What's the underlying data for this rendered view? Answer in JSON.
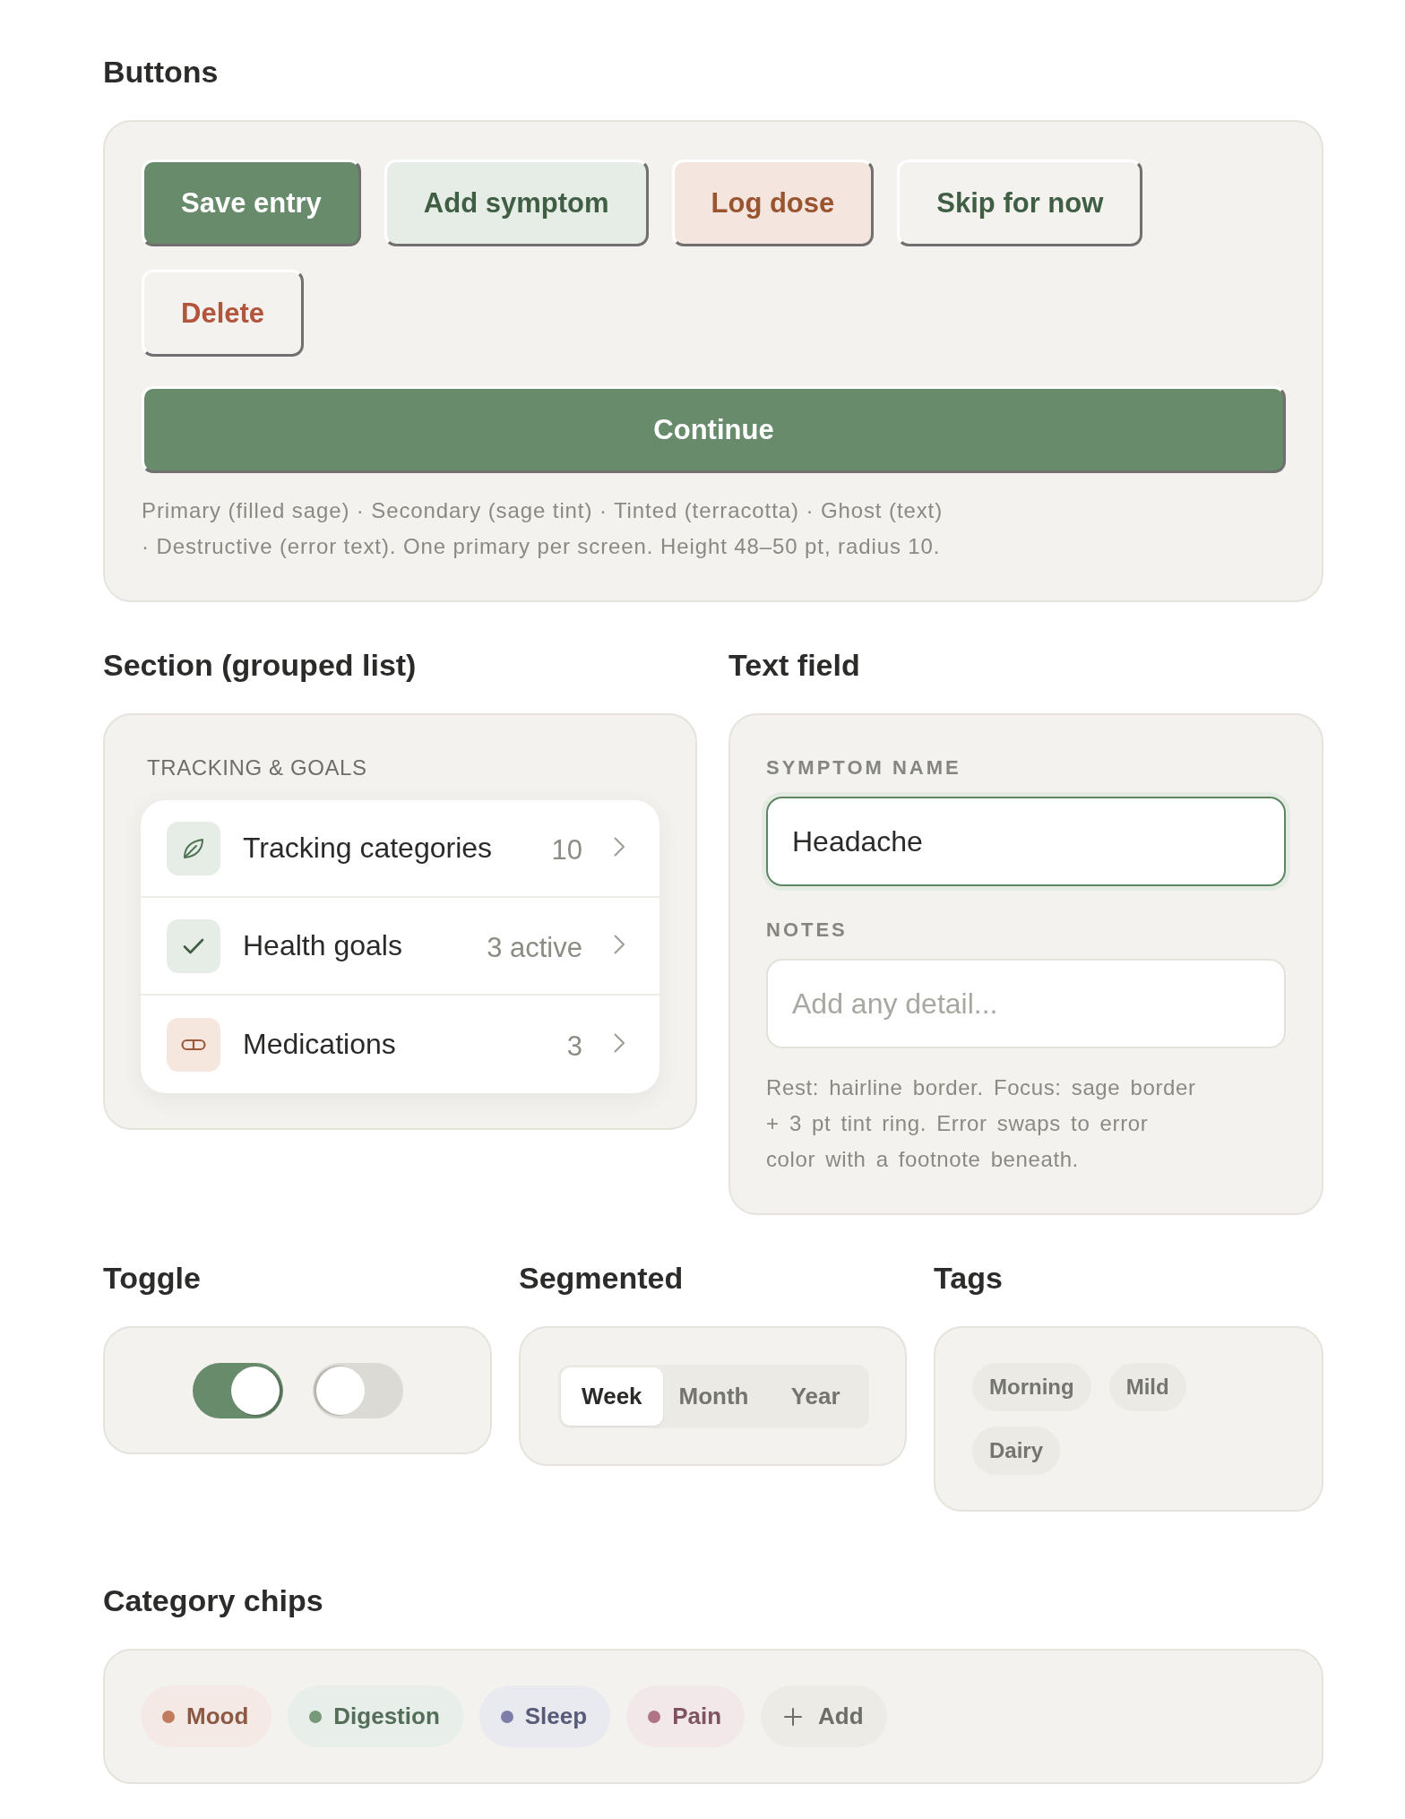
{
  "buttons_section": {
    "title": "Buttons",
    "buttons": [
      {
        "label": "Save entry",
        "kind": "primary"
      },
      {
        "label": "Add symptom",
        "kind": "secondary"
      },
      {
        "label": "Log dose",
        "kind": "tinted"
      },
      {
        "label": "Skip for now",
        "kind": "ghost"
      },
      {
        "label": "Delete",
        "kind": "destructive"
      }
    ],
    "block_button": {
      "label": "Continue",
      "kind": "primary"
    },
    "caption": "Primary (filled sage) · Secondary (sage tint) · Tinted (terracotta) · Ghost (text) · Destructive (error text). One primary per screen. Height 48–50 pt, radius 10."
  },
  "list_section": {
    "title": "Section (grouped list)",
    "header": "TRACKING & GOALS",
    "rows": [
      {
        "label": "Tracking categories",
        "value": "10",
        "kind": "categories"
      },
      {
        "label": "Health goals",
        "value": "3 active",
        "kind": "goals"
      },
      {
        "label": "Medications",
        "value": "3",
        "kind": "medications"
      }
    ]
  },
  "text_field_section": {
    "title": "Text field",
    "fields": [
      {
        "label": "SYMPTOM NAME",
        "value": "Headache",
        "focused": true
      },
      {
        "label": "NOTES",
        "placeholder": "Add any detail...",
        "focused": false
      }
    ],
    "caption": "Rest: hairline border. Focus: sage border + 3 pt tint ring. Error swaps to error color with a footnote beneath."
  },
  "toggle_section": {
    "title": "Toggle",
    "toggles": [
      {
        "on": true
      },
      {
        "on": false
      }
    ]
  },
  "segmented_section": {
    "title": "Segmented",
    "segments": [
      {
        "label": "Week",
        "selected": true
      },
      {
        "label": "Month",
        "selected": false
      },
      {
        "label": "Year",
        "selected": false
      }
    ]
  },
  "tags_section": {
    "title": "Tags",
    "tags": [
      "Morning",
      "Mild",
      "Dairy"
    ]
  },
  "chips_section": {
    "title": "Category chips",
    "chips": [
      {
        "label": "Mood",
        "kind": "category",
        "color": "#c17b5e"
      },
      {
        "label": "Digestion",
        "kind": "category",
        "color": "#76997b"
      },
      {
        "label": "Sleep",
        "kind": "category",
        "color": "#7c80a8"
      },
      {
        "label": "Pain",
        "kind": "category",
        "color": "#b07584"
      },
      {
        "label": "Add",
        "kind": "add"
      }
    ]
  }
}
